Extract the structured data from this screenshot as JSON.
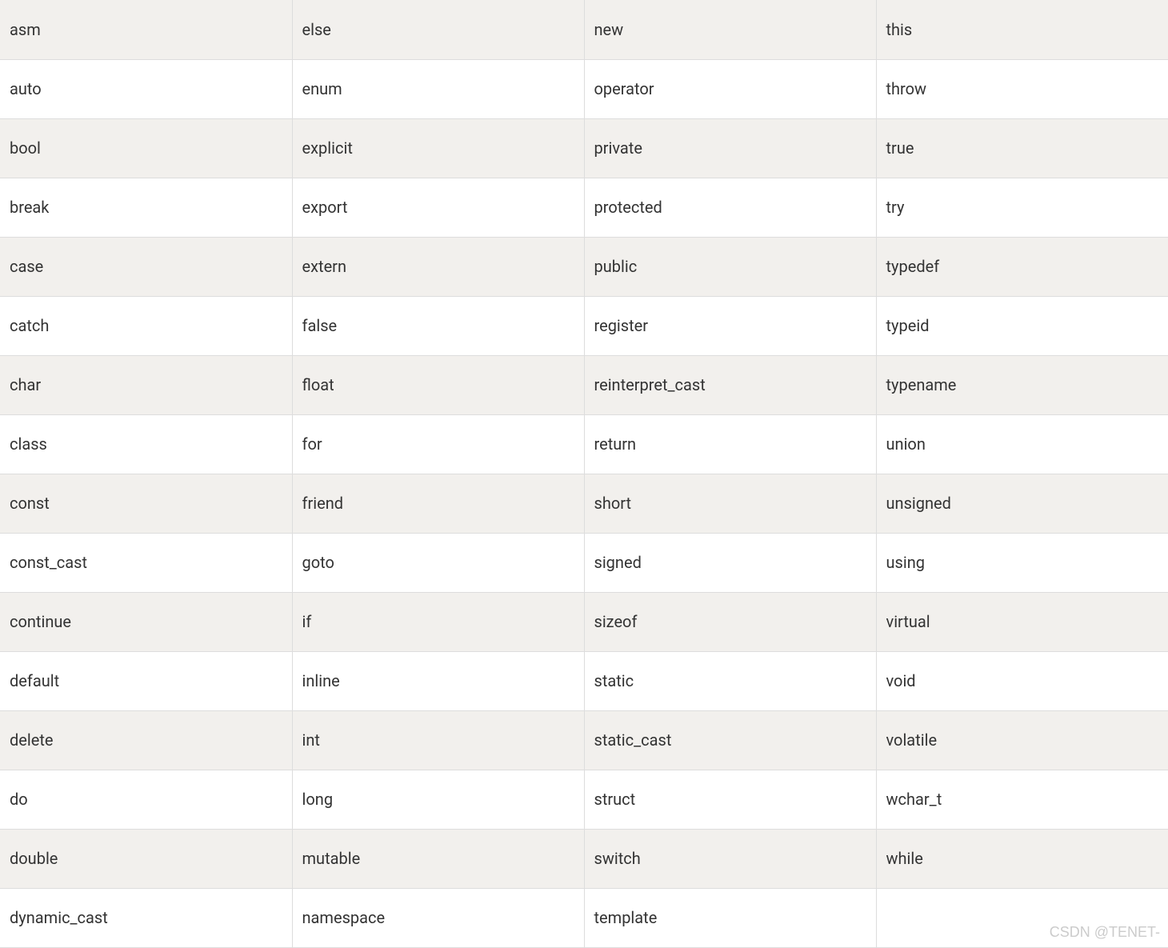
{
  "table": {
    "rows": [
      [
        "asm",
        "else",
        "new",
        "this"
      ],
      [
        "auto",
        "enum",
        "operator",
        "throw"
      ],
      [
        "bool",
        "explicit",
        "private",
        "true"
      ],
      [
        "break",
        "export",
        "protected",
        "try"
      ],
      [
        "case",
        "extern",
        "public",
        "typedef"
      ],
      [
        "catch",
        "false",
        "register",
        "typeid"
      ],
      [
        "char",
        "float",
        "reinterpret_cast",
        "typename"
      ],
      [
        "class",
        "for",
        "return",
        "union"
      ],
      [
        "const",
        "friend",
        "short",
        "unsigned"
      ],
      [
        "const_cast",
        "goto",
        "signed",
        "using"
      ],
      [
        "continue",
        "if",
        "sizeof",
        "virtual"
      ],
      [
        "default",
        "inline",
        "static",
        "void"
      ],
      [
        "delete",
        "int",
        "static_cast",
        "volatile"
      ],
      [
        "do",
        "long",
        "struct",
        "wchar_t"
      ],
      [
        "double",
        "mutable",
        "switch",
        "while"
      ],
      [
        "dynamic_cast",
        "namespace",
        "template",
        ""
      ]
    ]
  },
  "watermark": "CSDN @TENET-"
}
